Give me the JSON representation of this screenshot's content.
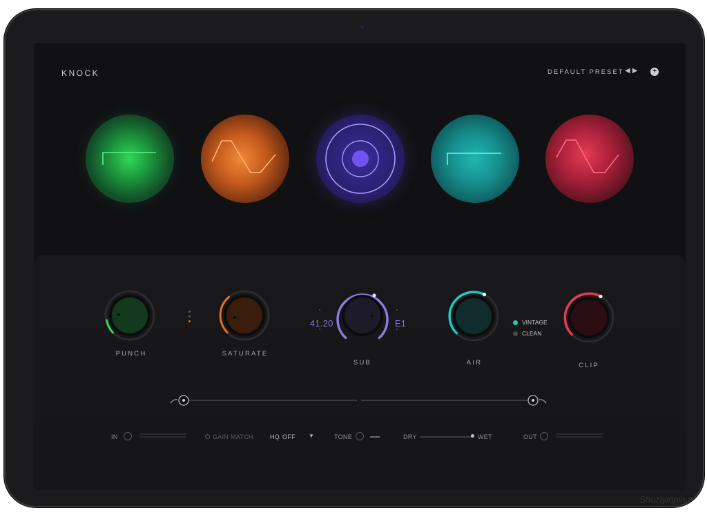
{
  "header": {
    "app_title": "KNOCK",
    "preset_name": "DEFAULT PRESET",
    "prev_icon": "prev-triangle",
    "next_icon": "next-triangle",
    "add_icon": "plus-circle"
  },
  "orbs": [
    {
      "name": "green",
      "color": "#2fd85a",
      "shape": "square-step"
    },
    {
      "name": "orange",
      "color": "#f2893a",
      "shape": "trapezoid-wave"
    },
    {
      "name": "purple",
      "color": "#8c79e6",
      "shape": "concentric-circles"
    },
    {
      "name": "teal",
      "color": "#1fb8b2",
      "shape": "square-step"
    },
    {
      "name": "red",
      "color": "#e43a54",
      "shape": "trapezoid-wave"
    }
  ],
  "knobs": {
    "punch": {
      "label": "PUNCH",
      "color": "#2fd85a"
    },
    "saturate": {
      "label": "SATURATE",
      "color": "#e36f24"
    },
    "sub": {
      "label": "SUB",
      "color": "#8c79e6",
      "frequency": "41.20",
      "note": "E1"
    },
    "air": {
      "label": "AIR",
      "color": "#22c7c0"
    },
    "clip": {
      "label": "CLIP",
      "color": "#e43a54"
    }
  },
  "air_mode": {
    "vintage": "VINTAGE",
    "clean": "CLEAN",
    "selected": "VINTAGE"
  },
  "footer": {
    "in_label": "IN",
    "gain_match": "GAIN MATCH",
    "hq_label": "HQ",
    "hq_value": "OFF",
    "hq_icon": "dropdown-triangle",
    "tone_label": "TONE",
    "dry_label": "DRY",
    "wet_label": "WET",
    "out_label": "OUT"
  },
  "watermark": "Shuziyinpin.v"
}
